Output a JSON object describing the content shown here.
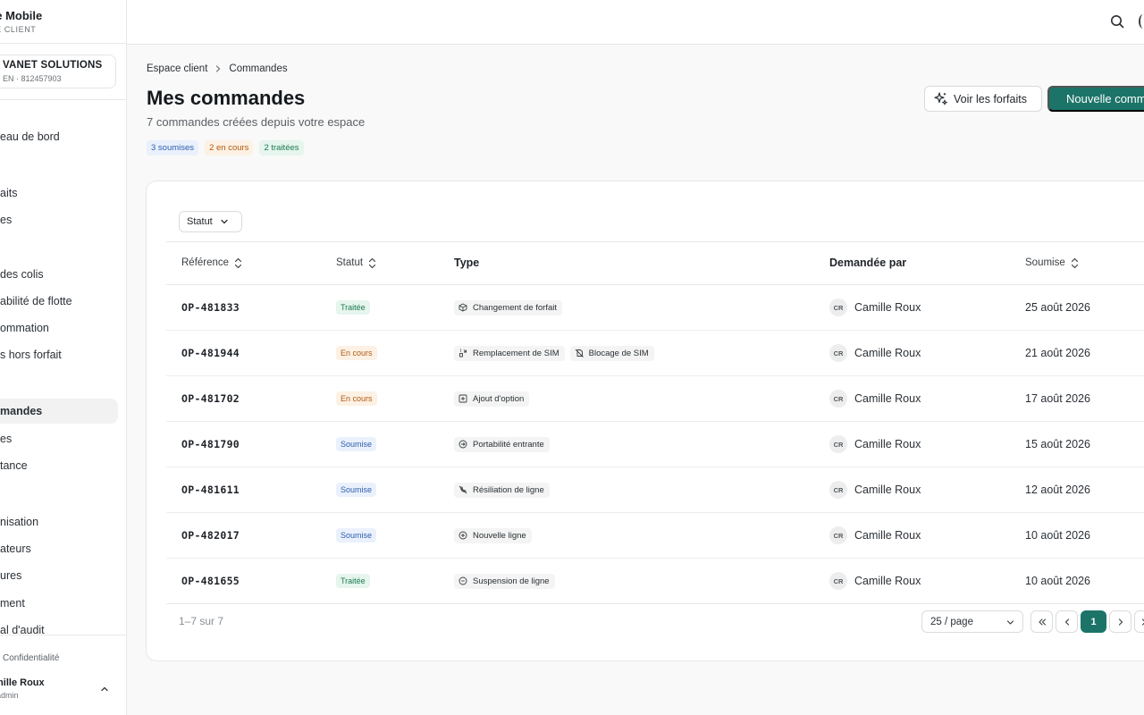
{
  "brand": {
    "name": "se Mobile",
    "subtitle": "CE CLIENT"
  },
  "org": {
    "name": "VANET SOLUTIONS",
    "siren": "EN · 812457903"
  },
  "sidebar": {
    "items": [
      {
        "label": "eau de bord"
      },
      {
        "label": "aits"
      },
      {
        "label": "es"
      },
      {
        "label": "des colis"
      },
      {
        "label": "abilité de flotte"
      },
      {
        "label": "ommation"
      },
      {
        "label": "s hors forfait"
      },
      {
        "label": "mandes"
      },
      {
        "label": "es"
      },
      {
        "label": "tance"
      },
      {
        "label": "nisation"
      },
      {
        "label": "ateurs"
      },
      {
        "label": "ures"
      },
      {
        "label": "ment"
      },
      {
        "label": "al d'audit"
      }
    ],
    "privacy": "Confidentialité",
    "user": {
      "name": "mille Roux",
      "role": "admin"
    }
  },
  "breadcrumb": {
    "root": "Espace client",
    "current": "Commandes"
  },
  "page": {
    "title": "Mes commandes",
    "subtitle": "7 commandes créées depuis votre espace",
    "pills": {
      "submitted": "3 soumises",
      "in_progress": "2 en cours",
      "processed": "2 traitées"
    }
  },
  "actions": {
    "plans": "Voir les forfaits",
    "new_order": "Nouvelle commande"
  },
  "filters": {
    "status": "Statut"
  },
  "table": {
    "headers": {
      "reference": "Référence",
      "status": "Statut",
      "type": "Type",
      "requested_by": "Demandée par",
      "submitted": "Soumise"
    },
    "rows": [
      {
        "ref": "OP-481833",
        "status": "Traitée",
        "status_kind": "traitee",
        "types": [
          {
            "label": "Changement de forfait",
            "icon": "package-icon"
          }
        ],
        "initials": "CR",
        "requester": "Camille Roux",
        "date": "25 août 2026"
      },
      {
        "ref": "OP-481944",
        "status": "En cours",
        "status_kind": "encours",
        "types": [
          {
            "label": "Remplacement de SIM",
            "icon": "sim-swap-icon"
          },
          {
            "label": "Blocage de SIM",
            "icon": "sim-block-icon"
          }
        ],
        "initials": "CR",
        "requester": "Camille Roux",
        "date": "21 août 2026"
      },
      {
        "ref": "OP-481702",
        "status": "En cours",
        "status_kind": "encours",
        "types": [
          {
            "label": "Ajout d'option",
            "icon": "plus-square-icon"
          }
        ],
        "initials": "CR",
        "requester": "Camille Roux",
        "date": "17 août 2026"
      },
      {
        "ref": "OP-481790",
        "status": "Soumise",
        "status_kind": "soumise",
        "types": [
          {
            "label": "Portabilité entrante",
            "icon": "arrow-in-circle-icon"
          }
        ],
        "initials": "CR",
        "requester": "Camille Roux",
        "date": "15 août 2026"
      },
      {
        "ref": "OP-481611",
        "status": "Soumise",
        "status_kind": "soumise",
        "types": [
          {
            "label": "Résiliation de ligne",
            "icon": "phone-off-icon"
          }
        ],
        "initials": "CR",
        "requester": "Camille Roux",
        "date": "12 août 2026"
      },
      {
        "ref": "OP-482017",
        "status": "Soumise",
        "status_kind": "soumise",
        "types": [
          {
            "label": "Nouvelle ligne",
            "icon": "plus-circle-icon"
          }
        ],
        "initials": "CR",
        "requester": "Camille Roux",
        "date": "10 août 2026"
      },
      {
        "ref": "OP-481655",
        "status": "Traitée",
        "status_kind": "traitee",
        "types": [
          {
            "label": "Suspension de ligne",
            "icon": "pause-circle-icon"
          }
        ],
        "initials": "CR",
        "requester": "Camille Roux",
        "date": "10 août 2026"
      }
    ]
  },
  "pagination": {
    "range": "1–7 sur 7",
    "page_size": "25 / page",
    "current_page": "1"
  },
  "colors": {
    "accent": "#1c7468",
    "submitted": "#2f5fae",
    "in_progress": "#b25b12",
    "processed": "#1c7a52"
  }
}
